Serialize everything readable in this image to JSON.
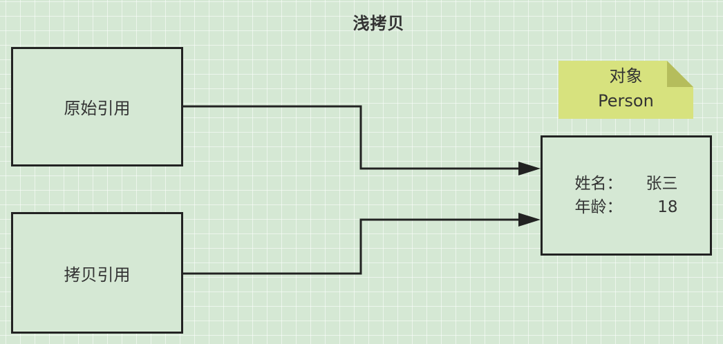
{
  "diagram": {
    "title": "浅拷贝",
    "nodes": {
      "original_ref": {
        "label": "原始引用"
      },
      "copy_ref": {
        "label": "拷贝引用"
      },
      "person": {
        "fields": [
          {
            "key": "姓名：",
            "value": "张三"
          },
          {
            "key": "年龄：",
            "value": "18"
          }
        ]
      }
    },
    "note": {
      "line1": "对象",
      "line2": "Person",
      "color": "#d7e27e"
    },
    "edges": [
      {
        "from": "原始引用",
        "to": "person"
      },
      {
        "from": "拷贝引用",
        "to": "person"
      }
    ],
    "colors": {
      "background": "#d5e8d4",
      "stroke": "#222222"
    }
  }
}
